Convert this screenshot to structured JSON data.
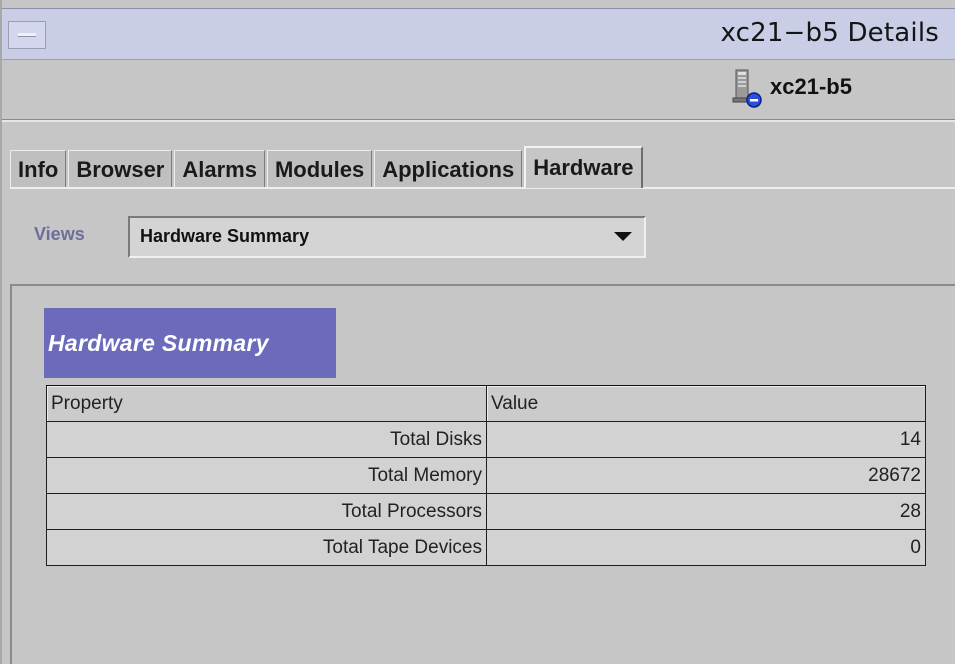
{
  "window": {
    "title": "xc21−b5 Details"
  },
  "host": {
    "name": "xc21-b5",
    "icon": "host-server-icon"
  },
  "tabs": [
    {
      "label": "Info",
      "active": false
    },
    {
      "label": "Browser",
      "active": false
    },
    {
      "label": "Alarms",
      "active": false
    },
    {
      "label": "Modules",
      "active": false
    },
    {
      "label": "Applications",
      "active": false
    },
    {
      "label": "Hardware",
      "active": true
    }
  ],
  "views": {
    "label": "Views",
    "selected": "Hardware Summary"
  },
  "summary": {
    "title": "Hardware Summary",
    "columns": [
      "Property",
      "Value"
    ],
    "rows": [
      {
        "property": "Total Disks",
        "value": "14"
      },
      {
        "property": "Total Memory",
        "value": "28672"
      },
      {
        "property": "Total Processors",
        "value": "28"
      },
      {
        "property": "Total Tape Devices",
        "value": "0"
      }
    ]
  },
  "colors": {
    "titlebar": "#c9cde6",
    "section_header": "#6c6aba",
    "views_label": "#6c6f9a",
    "background": "#c6c6c6"
  }
}
